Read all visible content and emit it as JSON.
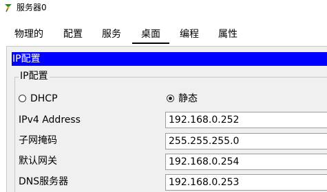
{
  "window": {
    "title": "服务器0"
  },
  "tabs": [
    {
      "label": "物理的"
    },
    {
      "label": "配置"
    },
    {
      "label": "服务"
    },
    {
      "label": "桌面",
      "active": true
    },
    {
      "label": "编程"
    },
    {
      "label": "属性"
    }
  ],
  "panel": {
    "header": "IP配置",
    "group_title": "IP配置",
    "mode": {
      "options": [
        {
          "label": "DHCP",
          "selected": false
        },
        {
          "label": "静态",
          "selected": true
        }
      ]
    },
    "fields": [
      {
        "label": "IPv4 Address",
        "value": "192.168.0.252"
      },
      {
        "label": "子网掩码",
        "value": "255.255.255.0"
      },
      {
        "label": "默认网关",
        "value": "192.168.0.254"
      },
      {
        "label": "DNS服务器",
        "value": "192.168.0.253"
      }
    ]
  },
  "colors": {
    "header_bg": "#0000ff",
    "header_fg": "#ffffff",
    "panel_bg": "#f0f0f0"
  },
  "icons": {
    "app": "packet-tracer-server-icon"
  }
}
